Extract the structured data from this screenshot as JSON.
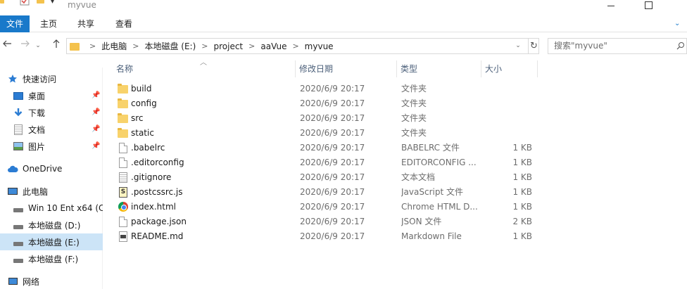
{
  "window": {
    "title": "myvue"
  },
  "ribbon": {
    "tabs": [
      "文件",
      "主页",
      "共享",
      "查看"
    ]
  },
  "address": {
    "crumbs": [
      "此电脑",
      "本地磁盘 (E:)",
      "project",
      "aaVue",
      "myvue"
    ]
  },
  "search": {
    "placeholder": "搜索\"myvue\""
  },
  "sidebar": {
    "items": [
      {
        "label": "快速访问",
        "icon": "star-icon",
        "pinned": false
      },
      {
        "label": "桌面",
        "icon": "desktop-icon",
        "pinned": true
      },
      {
        "label": "下载",
        "icon": "download-icon",
        "pinned": true
      },
      {
        "label": "文档",
        "icon": "document-icon",
        "pinned": true
      },
      {
        "label": "图片",
        "icon": "picture-icon",
        "pinned": true
      },
      {
        "label": "OneDrive",
        "icon": "cloud-icon",
        "pinned": false
      },
      {
        "label": "此电脑",
        "icon": "computer-icon",
        "pinned": false
      },
      {
        "label": "Win 10 Ent x64 (C:",
        "icon": "drive-icon",
        "pinned": false
      },
      {
        "label": "本地磁盘 (D:)",
        "icon": "drive-icon",
        "pinned": false
      },
      {
        "label": "本地磁盘 (E:)",
        "icon": "drive-icon",
        "pinned": false,
        "selected": true
      },
      {
        "label": "本地磁盘 (F:)",
        "icon": "drive-icon",
        "pinned": false
      },
      {
        "label": "网络",
        "icon": "network-icon",
        "pinned": false
      }
    ]
  },
  "columns": {
    "name": "名称",
    "date": "修改日期",
    "type": "类型",
    "size": "大小"
  },
  "files": [
    {
      "name": "build",
      "date": "2020/6/9 20:17",
      "type": "文件夹",
      "size": "",
      "icon": "folder-icon"
    },
    {
      "name": "config",
      "date": "2020/6/9 20:17",
      "type": "文件夹",
      "size": "",
      "icon": "folder-icon"
    },
    {
      "name": "src",
      "date": "2020/6/9 20:17",
      "type": "文件夹",
      "size": "",
      "icon": "folder-icon"
    },
    {
      "name": "static",
      "date": "2020/6/9 20:17",
      "type": "文件夹",
      "size": "",
      "icon": "folder-icon"
    },
    {
      "name": ".babelrc",
      "date": "2020/6/9 20:17",
      "type": "BABELRC 文件",
      "size": "1 KB",
      "icon": "file-icon"
    },
    {
      "name": ".editorconfig",
      "date": "2020/6/9 20:17",
      "type": "EDITORCONFIG ...",
      "size": "1 KB",
      "icon": "file-icon"
    },
    {
      "name": ".gitignore",
      "date": "2020/6/9 20:17",
      "type": "文本文档",
      "size": "1 KB",
      "icon": "text-file-icon"
    },
    {
      "name": ".postcssrc.js",
      "date": "2020/6/9 20:17",
      "type": "JavaScript 文件",
      "size": "1 KB",
      "icon": "js-file-icon"
    },
    {
      "name": "index.html",
      "date": "2020/6/9 20:17",
      "type": "Chrome HTML D...",
      "size": "1 KB",
      "icon": "chrome-icon"
    },
    {
      "name": "package.json",
      "date": "2020/6/9 20:17",
      "type": "JSON 文件",
      "size": "2 KB",
      "icon": "file-icon"
    },
    {
      "name": "README.md",
      "date": "2020/6/9 20:17",
      "type": "Markdown File",
      "size": "1 KB",
      "icon": "markdown-file-icon"
    }
  ]
}
